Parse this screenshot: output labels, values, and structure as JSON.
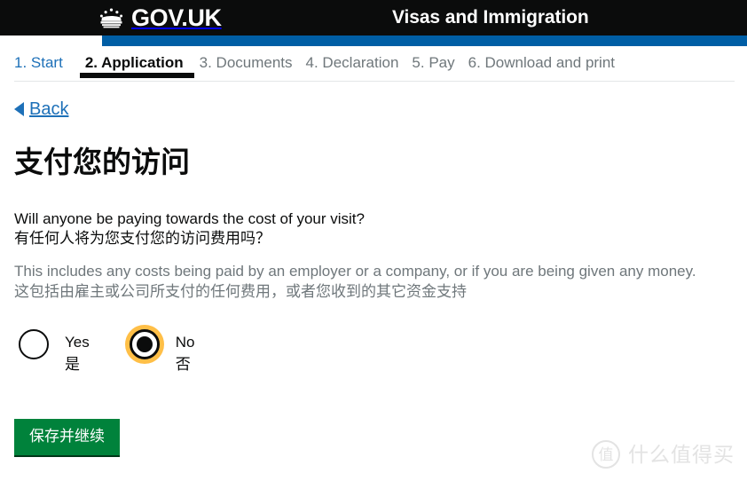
{
  "header": {
    "brand": "GOV.UK",
    "crown_icon": "crown-icon",
    "service_name": "Visas and Immigration",
    "black": "#0b0c0c",
    "blue_bar_color": "#005ea5"
  },
  "steps": [
    {
      "label": "1. Start",
      "state": "link"
    },
    {
      "label": "2. Application",
      "state": "current"
    },
    {
      "label": "3. Documents",
      "state": "inactive"
    },
    {
      "label": "4. Declaration",
      "state": "inactive"
    },
    {
      "label": "5. Pay",
      "state": "inactive"
    },
    {
      "label": "6. Download and print",
      "state": "inactive"
    }
  ],
  "back": {
    "label": "Back",
    "icon": "back-arrow-icon",
    "color": "#1d70b8"
  },
  "main": {
    "title": "支付您的访问",
    "question_en": "Will anyone be paying towards the cost of your visit?",
    "question_zh": "有任何人将为您支付您的访问费用吗？",
    "hint_en": "This includes any costs being paid by an employer or a company, or if you are being given any money.",
    "hint_zh": "这包括由雇主或公司所支付的任何费用，或者您收到的其它资金支持",
    "hint_color": "#6f777b"
  },
  "radios": [
    {
      "name": "yes",
      "label_en": "Yes",
      "label_zh": "是",
      "selected": false,
      "focused": false
    },
    {
      "name": "no",
      "label_en": "No",
      "label_zh": "否",
      "selected": true,
      "focused": true
    }
  ],
  "focus_color": "#ffbf47",
  "submit": {
    "label": "保存并继续",
    "color": "#00823b"
  },
  "watermark": {
    "badge": "值",
    "text": "什么值得买"
  }
}
